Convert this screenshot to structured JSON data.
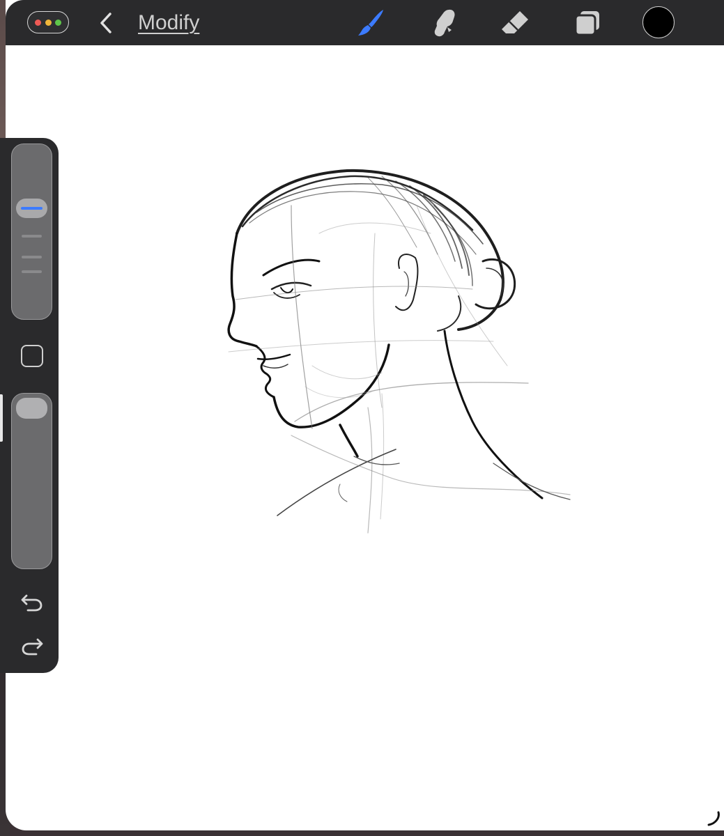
{
  "topbar": {
    "modify_label": "Modify",
    "traffic_colors": [
      "#ef5a55",
      "#f0b63a",
      "#5fc64a"
    ],
    "tools": [
      {
        "name": "paintbrush-icon",
        "active": true,
        "color": "#3c7bff"
      },
      {
        "name": "smudge-icon",
        "active": false,
        "color": "#cfcfcf"
      },
      {
        "name": "eraser-icon",
        "active": false,
        "color": "#cfcfcf"
      },
      {
        "name": "layers-icon",
        "active": false,
        "color": "#cfcfcf"
      }
    ],
    "current_color": "#000000"
  },
  "sidebar": {
    "brush_size_slider": {
      "value_fraction": 0.72
    },
    "brush_opacity_slider": {
      "value_fraction": 1.0
    },
    "undo_icon": "undo-arrow-icon",
    "redo_icon": "redo-arrow-icon"
  },
  "canvas": {
    "content": "pencil-sketch-head-portrait",
    "background": "#ffffff"
  }
}
